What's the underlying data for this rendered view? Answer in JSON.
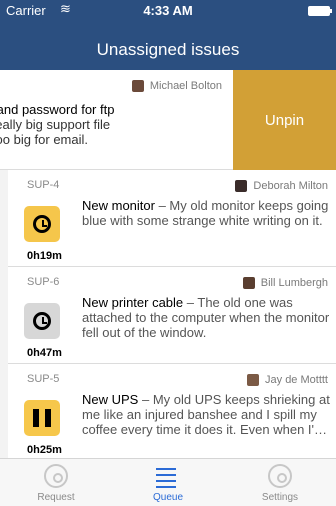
{
  "status_bar": {
    "carrier": "Carrier",
    "time": "4:33 AM",
    "wifi_icon": "wifi-icon",
    "battery_icon": "battery-icon"
  },
  "header": {
    "title": "Unassigned issues"
  },
  "swiped_row": {
    "assignee": "Michael Bolton",
    "title_line": "orary username and password for ftp",
    "body_lines": [
      "ed to receive a really big support file",
      "a customer, it's too big for email."
    ],
    "action_label": "Unpin",
    "action_color": "#d2a036"
  },
  "issues": [
    {
      "key": "SUP-4",
      "assignee": "Deborah Milton",
      "status_icon": "clock-icon",
      "status_color": "#f5c64b",
      "elapsed": "0h19m",
      "summary_title": "New monitor",
      "summary_body": " – My old monitor keeps going blue with some strange white writing on it."
    },
    {
      "key": "SUP-6",
      "assignee": "Bill Lumbergh",
      "status_icon": "clock-icon",
      "status_color": "#d7d7d7",
      "elapsed": "0h47m",
      "summary_title": "New printer cable",
      "summary_body": " – The old one was attached to the computer when the monitor fell out of the window."
    },
    {
      "key": "SUP-5",
      "assignee": "Jay de Motttt",
      "status_icon": "pause-icon",
      "status_color": "#f6c74b",
      "elapsed": "0h25m",
      "summary_title": "New UPS",
      "summary_body": " – My old UPS keeps shrieking at me like an injured banshee and I spill my coffee every time it does it. Even when I'…"
    }
  ],
  "tabbar": {
    "items": [
      {
        "label": "Request",
        "icon": "target-icon",
        "active": false
      },
      {
        "label": "Queue",
        "icon": "list-icon",
        "active": true
      },
      {
        "label": "Settings",
        "icon": "gear-icon",
        "active": false
      }
    ],
    "active_color": "#2b6bd6"
  }
}
